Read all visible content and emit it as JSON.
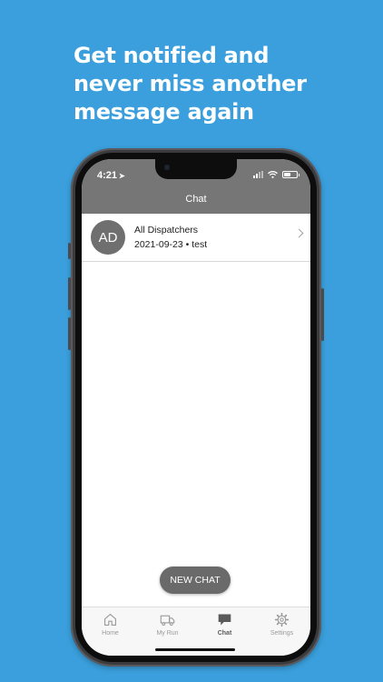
{
  "headline": {
    "line1": "Get notified and",
    "line2": "never miss another",
    "line3": "message again"
  },
  "status_bar": {
    "time": "4:21",
    "icons": [
      "location-arrow-icon",
      "signal-icon",
      "wifi-icon",
      "battery-icon"
    ]
  },
  "nav": {
    "title": "Chat"
  },
  "chats": [
    {
      "initials": "AD",
      "name": "All Dispatchers",
      "subtitle": "2021-09-23 • test"
    }
  ],
  "new_chat_label": "NEW CHAT",
  "tabs": [
    {
      "label": "Home",
      "icon": "home-icon",
      "active": false
    },
    {
      "label": "My Run",
      "icon": "truck-icon",
      "active": false
    },
    {
      "label": "Chat",
      "icon": "chat-bubble-icon",
      "active": true
    },
    {
      "label": "Settings",
      "icon": "gear-icon",
      "active": false
    }
  ],
  "colors": {
    "background": "#3a9fdc",
    "header": "#767676",
    "avatar": "#6f6f6f",
    "button": "#6a6a6a"
  }
}
